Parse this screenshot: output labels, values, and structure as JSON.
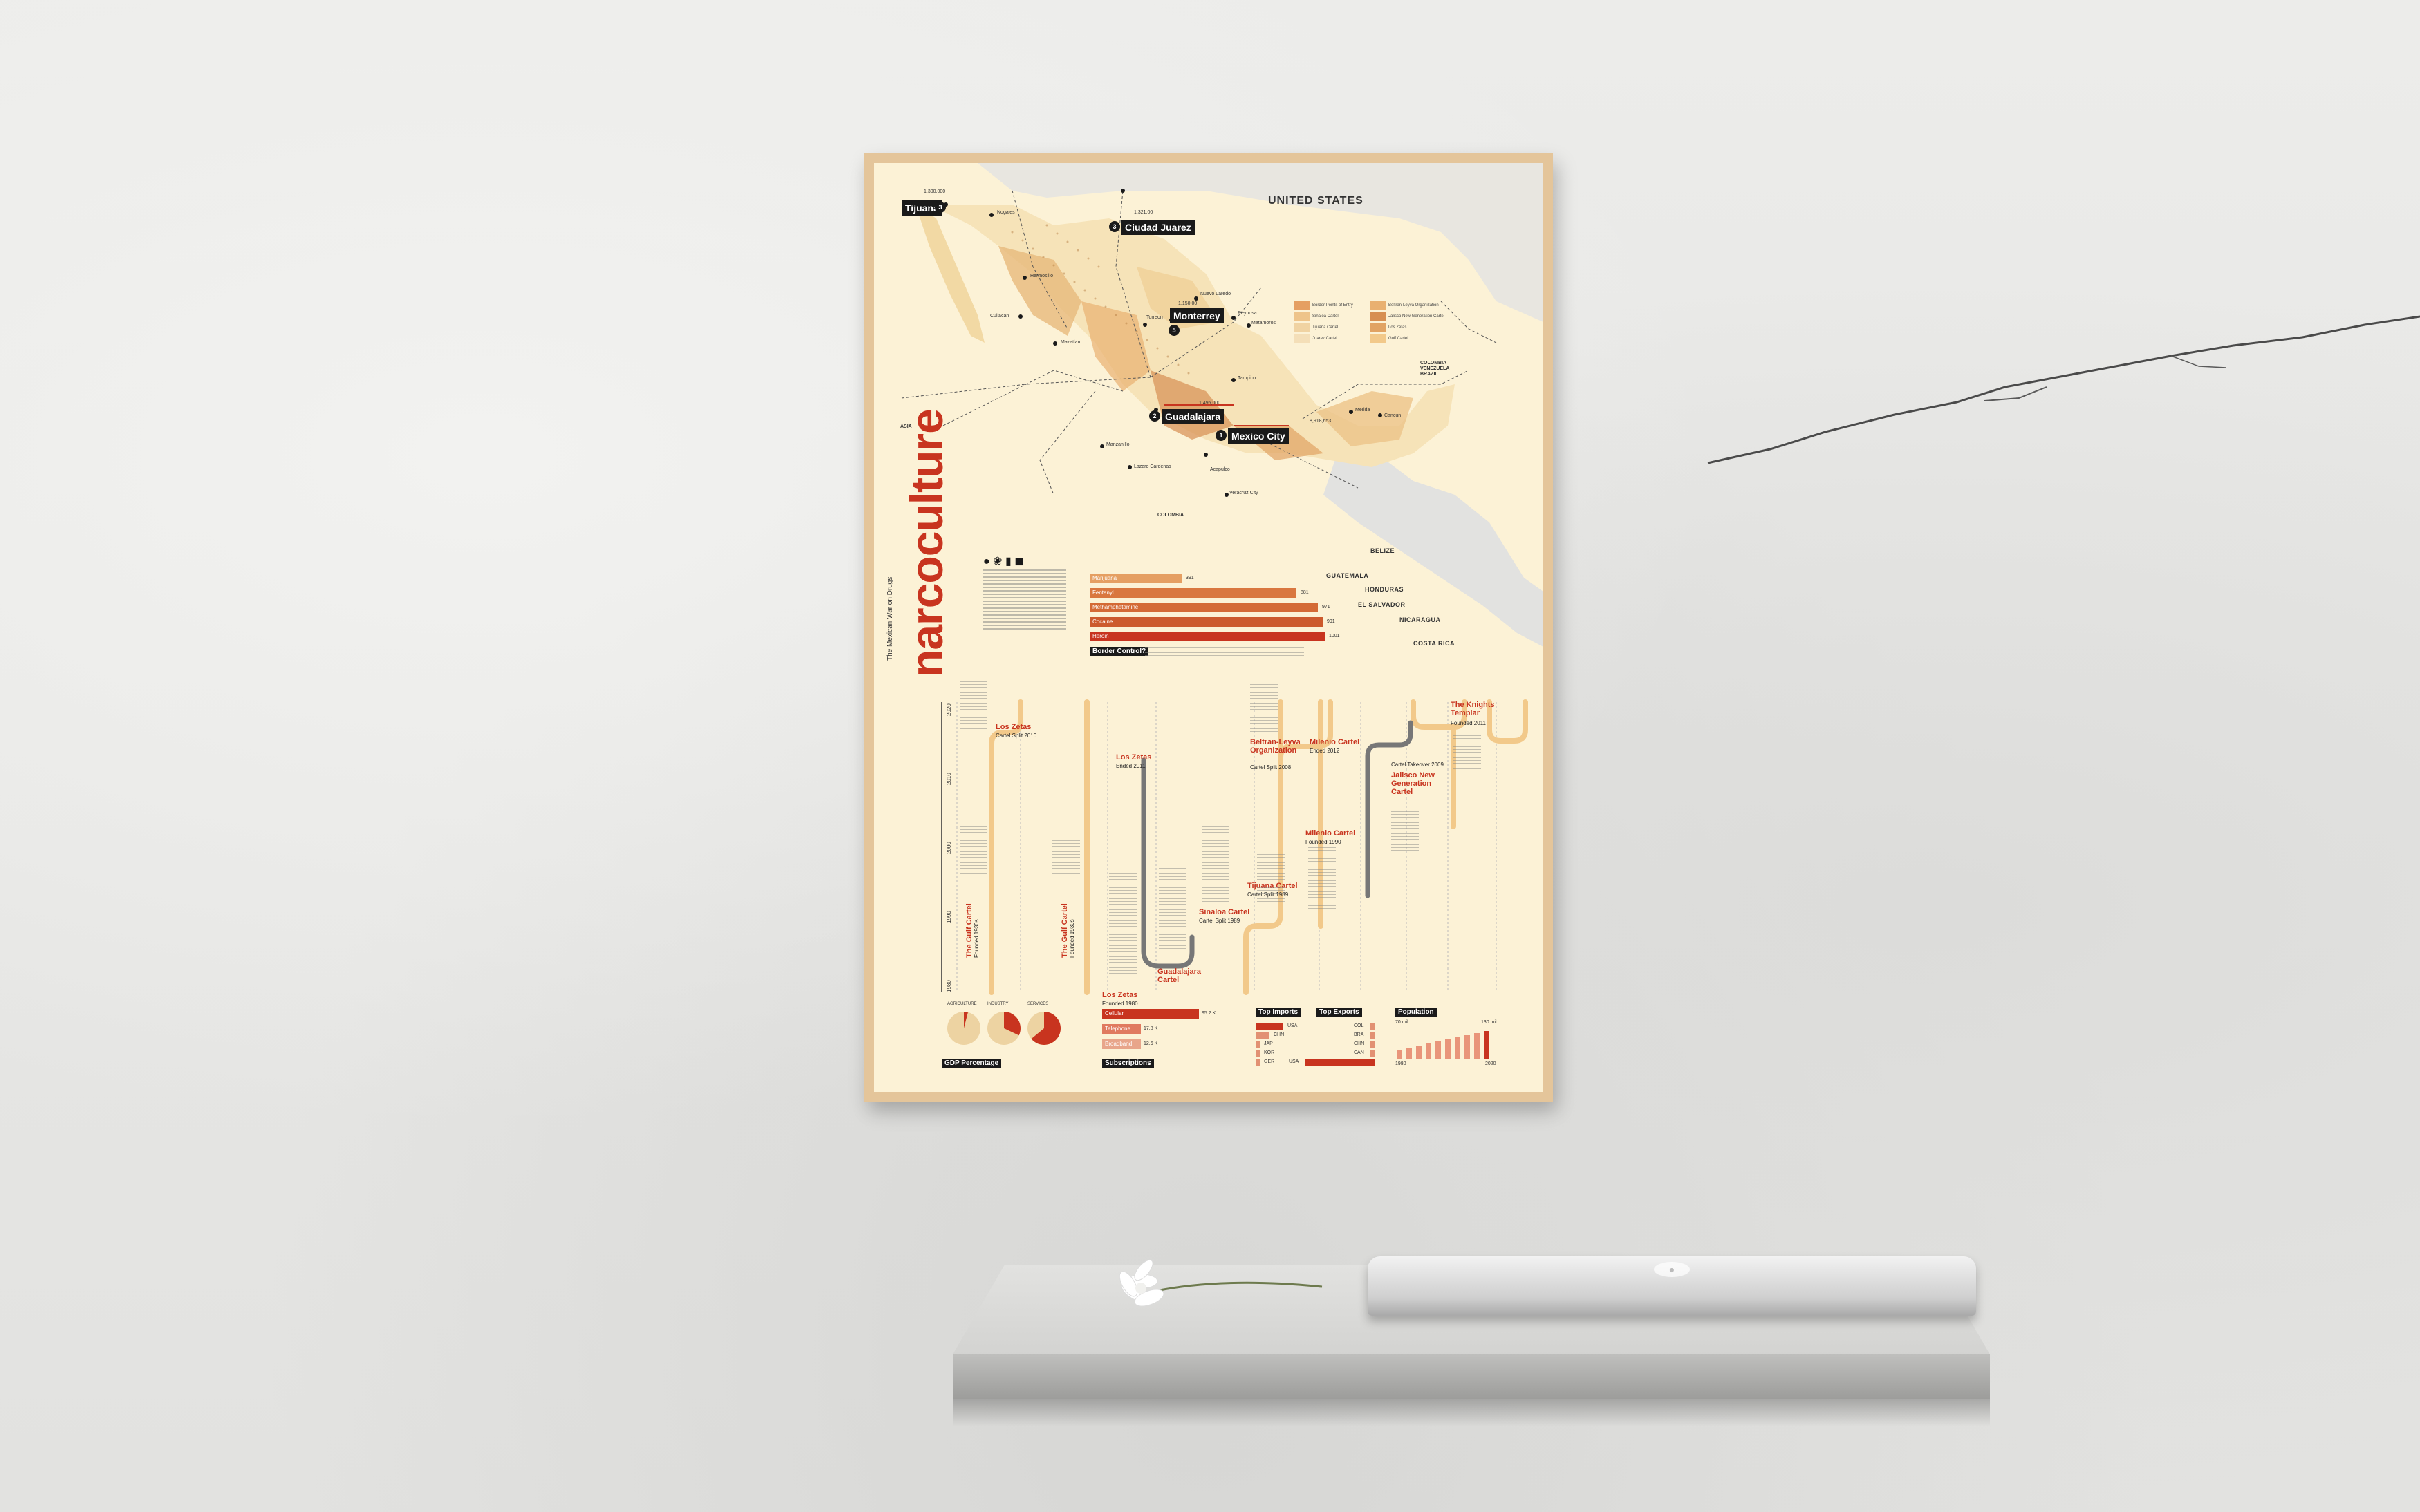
{
  "poster": {
    "title": "narcoculture",
    "subtitle": "The Mexican War on Drugs",
    "countries": {
      "us": "UNITED STATES",
      "belize": "BELIZE",
      "guatemala": "GUATEMALA",
      "honduras": "HONDURAS",
      "el_salvador": "EL SALVADOR",
      "nicaragua": "NICARAGUA",
      "costa_rica": "COSTA RICA",
      "asia": "ASIA",
      "colombia": "COLOMBIA",
      "south": "COLOMBIA VENEZUELA BRAZIL"
    },
    "cities": {
      "tijuana": "Tijuana",
      "ciudad_juarez": "Ciudad Juarez",
      "monterrey": "Monterrey",
      "guadalajara": "Guadalajara",
      "mexico_city": "Mexico City",
      "tijuana_num": "3",
      "juarez_num": "3",
      "monterrey_num": "5",
      "guadalajara_num": "2",
      "mexico_num": "1",
      "tijuana_pop": "1,300,000",
      "juarez_pop": "1,321,00",
      "monterrey_pop": "1,150,00",
      "guadalajara_pop": "1,495,000",
      "mexico_pop": "8,918,653"
    },
    "small_cities": [
      "Nogales",
      "Hermosillo",
      "Culiacan",
      "Mazatlan",
      "Torreon",
      "Nuevo Laredo",
      "Reynosa",
      "Matamoros",
      "Tampico",
      "Manzanillo",
      "Lazaro Cardenas",
      "Acapulco",
      "Veracruz City",
      "Merida",
      "Cancun"
    ],
    "legend": [
      "Border Points of Entry",
      "Sinaloa Cartel",
      "Tijuana Cartel",
      "Juarez Cartel",
      "Beltran-Leyva Organization",
      "Jalisco New Generation Cartel",
      "Los Zetas",
      "Gulf Cartel"
    ],
    "border_bars": {
      "items": [
        {
          "label": "Marijuana",
          "value": 391
        },
        {
          "label": "Fentanyl",
          "value": 881
        },
        {
          "label": "Methamphetamine",
          "value": 971
        },
        {
          "label": "Cocaine",
          "value": 991
        },
        {
          "label": "Heroin",
          "value": 1001
        }
      ],
      "max": 1001,
      "tag": "Border Control?"
    },
    "timeline": {
      "years": [
        "2020",
        "2010",
        "2000",
        "1990",
        "1980"
      ],
      "cartels": [
        {
          "name": "The Gulf Cartel",
          "sub": "Founded 1930s"
        },
        {
          "name": "Los Zetas",
          "sub": "Cartel Split 2010"
        },
        {
          "name": "The Gulf Cartel",
          "sub": "Founded 1930s"
        },
        {
          "name": "Los Zetas",
          "sub": "Ended 2011"
        },
        {
          "name": "Los Zetas",
          "sub": "Founded 1980"
        },
        {
          "name": "Guadalajara Cartel",
          "sub": ""
        },
        {
          "name": "Sinaloa Cartel",
          "sub": "Cartel Split 1989"
        },
        {
          "name": "Tijuana Cartel",
          "sub": "Cartel Split 1989"
        },
        {
          "name": "Beltran-Leyva Organization",
          "sub": "Cartel Split 2008"
        },
        {
          "name": "Milenio Cartel",
          "sub": "Founded 1990"
        },
        {
          "name": "Milenio Cartel",
          "sub": "Ended 2012"
        },
        {
          "name": "Jalisco New Generation Cartel",
          "sub": "Cartel Takeover 2009"
        },
        {
          "name": "The Knights Templar",
          "sub": "Founded 2011"
        }
      ]
    },
    "gdp": {
      "labels": [
        "AGRICULTURE",
        "INDUSTRY",
        "SERVICES"
      ],
      "values": [
        4,
        32,
        64
      ],
      "tag": "GDP Percentage"
    },
    "subscriptions": {
      "items": [
        {
          "label": "Cellular",
          "value": "95.2 K"
        },
        {
          "label": "Telephone",
          "value": "17.8 K"
        },
        {
          "label": "Broadband",
          "value": "12.6 K"
        }
      ],
      "fractions": [
        1.0,
        0.19,
        0.13
      ],
      "tag": "Subscriptions"
    },
    "trade": {
      "imports_tag": "Top Imports",
      "exports_tag": "Top Exports",
      "imports": [
        "USA",
        "CHN",
        "JAP",
        "KOR",
        "GER"
      ],
      "exports": [
        "USA",
        "CAN",
        "CHN",
        "BRA",
        "COL"
      ],
      "import_fractions": [
        1.0,
        0.5,
        0.1,
        0.08,
        0.08
      ],
      "export_fractions": [
        1.0,
        0.06,
        0.04,
        0.03,
        0.02
      ]
    },
    "population": {
      "tag": "Population",
      "start_value": "70 mil",
      "end_value": "130 mil",
      "start_year": "1980",
      "end_year": "2020",
      "levels": [
        0.3,
        0.38,
        0.46,
        0.54,
        0.62,
        0.7,
        0.78,
        0.86,
        0.93,
        1.0
      ]
    }
  },
  "colors": {
    "accent": "#c8341f",
    "poster_bg": "#fcf2d6",
    "map_land": "#f6e3b8",
    "path": "#f2c98a"
  }
}
